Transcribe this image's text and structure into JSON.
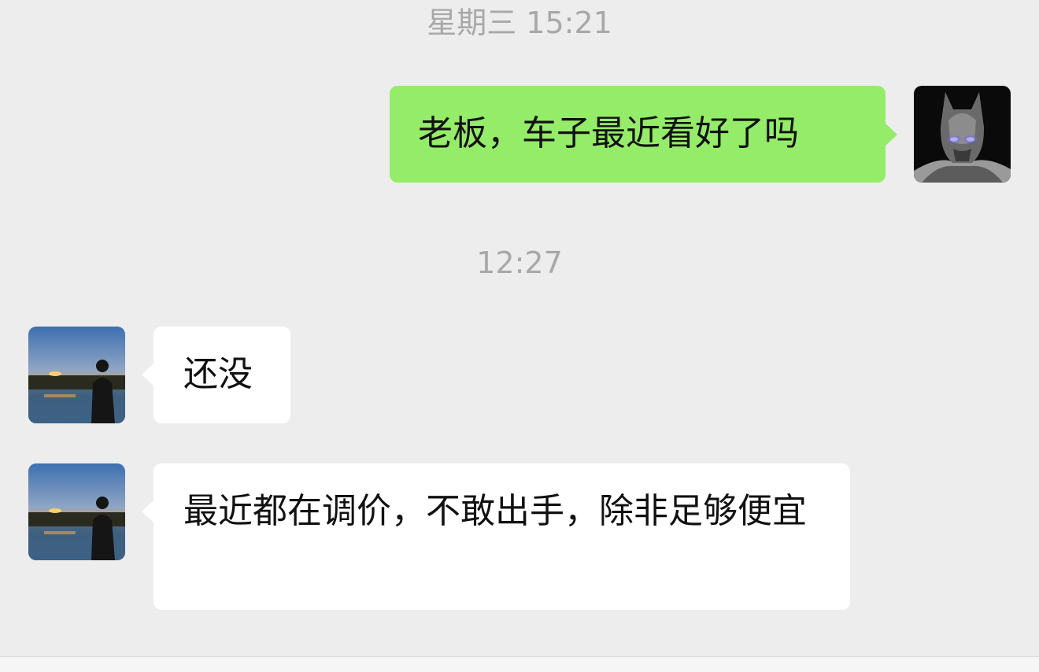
{
  "timestamps": {
    "first": "星期三 15:21",
    "second": "12:27"
  },
  "messages": [
    {
      "sender": "self",
      "text": "老板，车子最近看好了吗",
      "avatar_icon": "batman-avatar-icon"
    },
    {
      "sender": "peer",
      "text": "还没",
      "avatar_icon": "sunset-silhouette-avatar-icon"
    },
    {
      "sender": "peer",
      "text": "最近都在调价，不敢出手，除非足够便宜",
      "avatar_icon": "sunset-silhouette-avatar-icon"
    }
  ],
  "colors": {
    "background": "#ededed",
    "outgoing_bubble": "#95ec69",
    "incoming_bubble": "#ffffff",
    "timestamp_text": "#a8a8a8",
    "message_text": "#111111"
  }
}
